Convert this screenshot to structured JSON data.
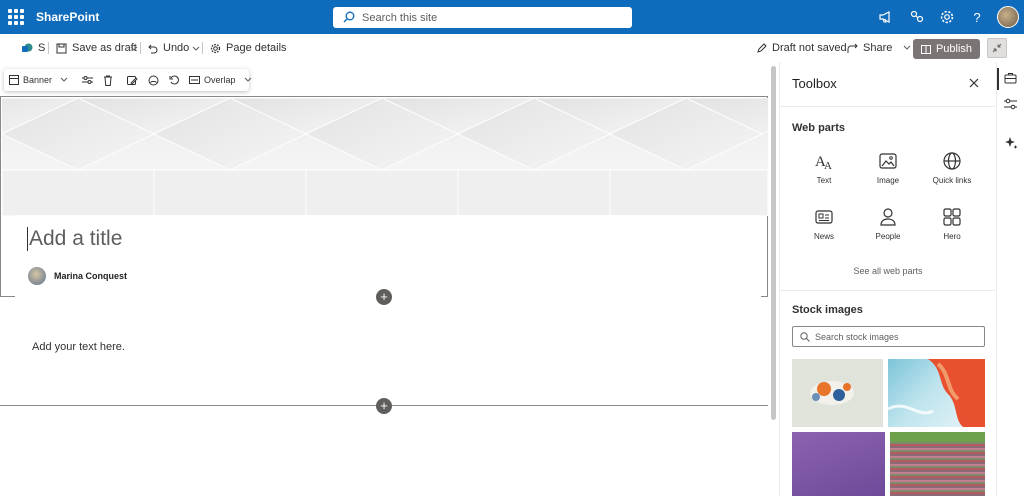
{
  "topbar": {
    "brand": "SharePoint",
    "search_placeholder": "Search this site",
    "icons": [
      "waffle-icon",
      "megaphone-icon",
      "share-network-icon",
      "gear-icon",
      "help-icon",
      "avatar"
    ]
  },
  "cmdbar": {
    "site_initial": "S",
    "save_draft": "Save as draft",
    "undo": "Undo",
    "page_details": "Page details",
    "draft_status": "Draft not saved",
    "share": "Share",
    "publish": "Publish"
  },
  "webpart_toolbar": {
    "layout": "Banner",
    "overlay": "Overlap"
  },
  "banner": {
    "title_placeholder": "Add a title",
    "author": "Marina Conquest"
  },
  "text_section": {
    "placeholder": "Add your text here."
  },
  "toolbox": {
    "title": "Toolbox",
    "web_parts_heading": "Web parts",
    "web_parts": [
      {
        "label": "Text",
        "icon": "text-icon"
      },
      {
        "label": "Image",
        "icon": "image-icon"
      },
      {
        "label": "Quick links",
        "icon": "globe-icon"
      },
      {
        "label": "News",
        "icon": "news-icon"
      },
      {
        "label": "People",
        "icon": "person-icon"
      },
      {
        "label": "Hero",
        "icon": "hero-grid-icon"
      }
    ],
    "see_all": "See all web parts",
    "stock_heading": "Stock images",
    "stock_search_placeholder": "Search stock images"
  },
  "colors": {
    "brand_blue": "#0f6cbd",
    "publish_gray": "#7a7574"
  }
}
